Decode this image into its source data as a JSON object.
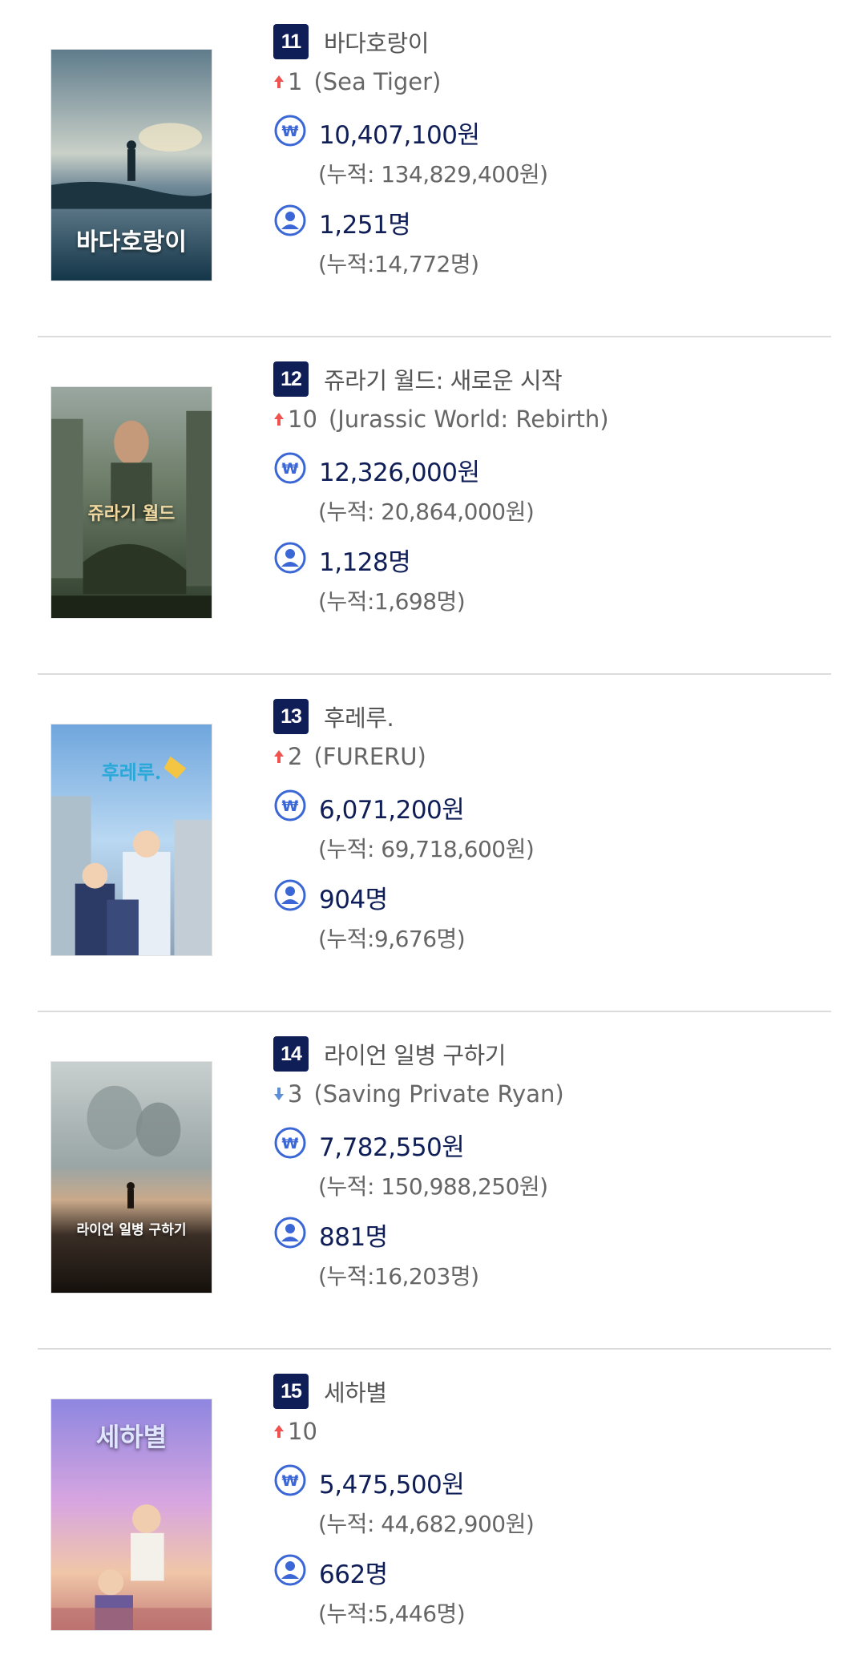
{
  "items": [
    {
      "rank": "11",
      "title_ko": "바다호랑이",
      "change_dir": "up",
      "change": "1",
      "title_en": "(Sea Tiger)",
      "sales": "10,407,100원",
      "sales_total": "(누적: 134,829,400원)",
      "audience": "1,251명",
      "audience_total": "(누적:14,772명)",
      "poster_text": "바다호랑이"
    },
    {
      "rank": "12",
      "title_ko": "쥬라기 월드: 새로운 시작",
      "change_dir": "up",
      "change": "10",
      "title_en": "(Jurassic World: Rebirth)",
      "sales": "12,326,000원",
      "sales_total": "(누적: 20,864,000원)",
      "audience": "1,128명",
      "audience_total": "(누적:1,698명)",
      "poster_text": "쥬라기 월드"
    },
    {
      "rank": "13",
      "title_ko": "후레루.",
      "change_dir": "up",
      "change": "2",
      "title_en": "(FURERU)",
      "sales": "6,071,200원",
      "sales_total": "(누적: 69,718,600원)",
      "audience": "904명",
      "audience_total": "(누적:9,676명)",
      "poster_text": "후레루."
    },
    {
      "rank": "14",
      "title_ko": "라이언 일병 구하기",
      "change_dir": "down",
      "change": "3",
      "title_en": "(Saving Private Ryan)",
      "sales": "7,782,550원",
      "sales_total": "(누적: 150,988,250원)",
      "audience": "881명",
      "audience_total": "(누적:16,203명)",
      "poster_text": "라이언 일병 구하기"
    },
    {
      "rank": "15",
      "title_ko": "세하별",
      "change_dir": "up",
      "change": "10",
      "title_en": "",
      "sales": "5,475,500원",
      "sales_total": "(누적: 44,682,900원)",
      "audience": "662명",
      "audience_total": "(누적:5,446명)",
      "poster_text": "세하별"
    }
  ],
  "colors": {
    "badge": "#0f1e57",
    "value_text": "#0f1e57",
    "muted_text": "#666666",
    "arrow_up": "#ef5350",
    "arrow_down": "#5c8fd6",
    "icon_blue": "#3a66d6"
  },
  "icons": {
    "money": "won-coin-icon",
    "audience": "person-icon",
    "up": "arrow-up-icon",
    "down": "arrow-down-icon"
  }
}
